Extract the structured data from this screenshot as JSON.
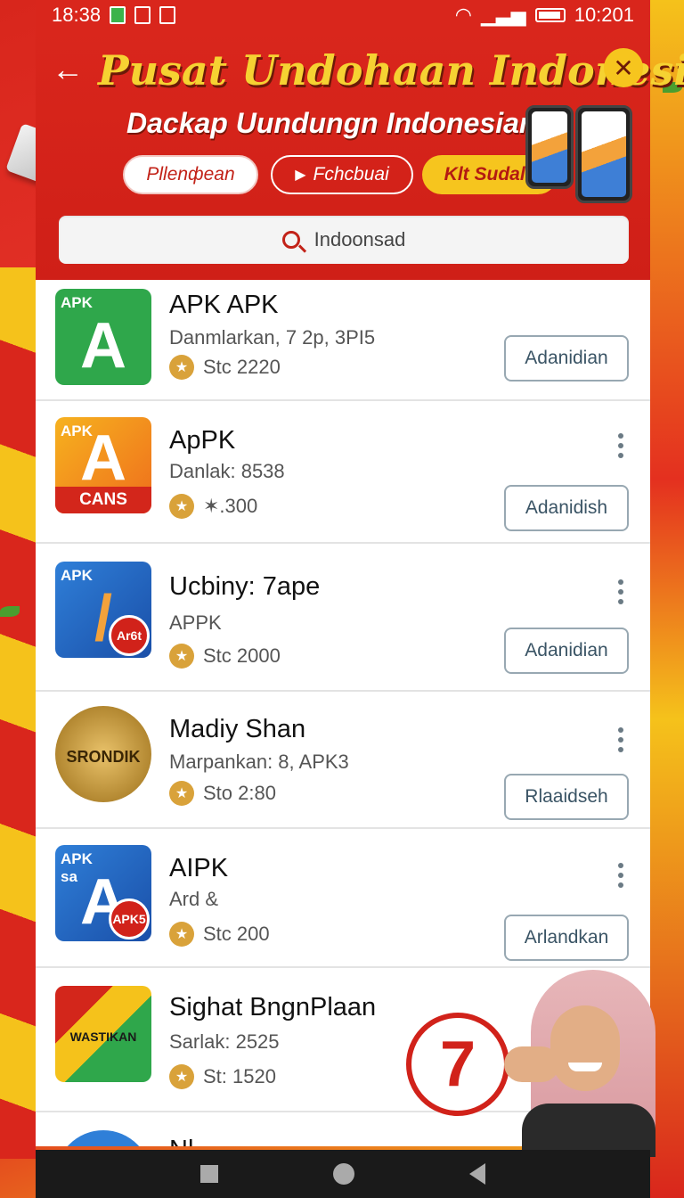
{
  "status_bar": {
    "time_left": "18:38",
    "time_right": "10:201"
  },
  "header": {
    "title": "Pusat Undohaan Indonesia",
    "subtitle": "Dackap Uundungn Indonesian",
    "pills": [
      "Pllenфean",
      "Fchcbuai",
      "Klt Sudale"
    ]
  },
  "search": {
    "value": "Indoonsad"
  },
  "apps": [
    {
      "name": "APK APK",
      "sub": "Danmlarkan, 7 2p, 3PI5",
      "rating": "Stc 2220",
      "button": "Adanidian",
      "icon_tag": "APK",
      "icon_glyph": "A",
      "icon_style": "green"
    },
    {
      "name": "ApPK",
      "sub": "Danlak: 8538",
      "rating": "✶.300",
      "button": "Adanidish",
      "icon_tag": "APK",
      "icon_glyph": "A",
      "icon_style": "orange",
      "icon_band": "CANS"
    },
    {
      "name": "Ucbiny: 7ape",
      "sub": "APPK",
      "rating": "Stc 2000",
      "button": "Adanidian",
      "icon_tag": "APK",
      "icon_glyph": "/",
      "icon_style": "blue",
      "icon_badge": "Ar6t"
    },
    {
      "name": "Madіy Shan",
      "sub": "Marpankan: 8, APK3",
      "rating": "Sto 2:80",
      "button": "Rlaaidseh",
      "icon_tag": "",
      "icon_glyph": "SRONDIK",
      "icon_style": "gold"
    },
    {
      "name": "AIPK",
      "sub": "Ard &",
      "rating": "Stc 200",
      "button": "Arlandkan",
      "icon_tag": "APK sa",
      "icon_glyph": "A",
      "icon_style": "blue2",
      "icon_badge": "APK5"
    },
    {
      "name": "Sighat BngnPlaan",
      "sub": "Sarlak: 2525",
      "rating": "St: 1520",
      "button": "",
      "icon_tag": "",
      "icon_glyph": "WASTIKAN",
      "icon_style": "flag"
    }
  ],
  "partial_row_name": "Nl...",
  "promo_number": "7",
  "colors": {
    "primary_red": "#d9261c",
    "accent_yellow": "#f6c51e",
    "button_border": "#98a8b2"
  }
}
